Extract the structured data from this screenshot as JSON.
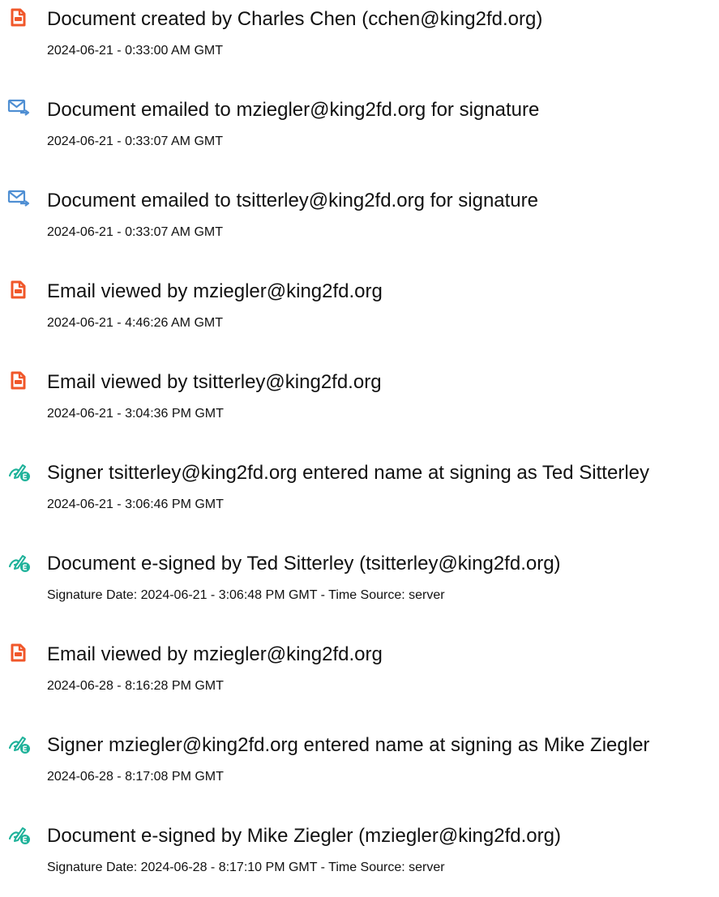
{
  "colors": {
    "doc_icon": "#f0572a",
    "email_icon": "#4f8fd3",
    "sign_icon": "#1fb29a"
  },
  "events": [
    {
      "icon": "document-icon",
      "title": "Document created by Charles Chen (cchen@king2fd.org)",
      "time": "2024-06-21 - 0:33:00 AM GMT"
    },
    {
      "icon": "email-sent-icon",
      "title": "Document emailed to mziegler@king2fd.org for signature",
      "time": "2024-06-21 - 0:33:07 AM GMT"
    },
    {
      "icon": "email-sent-icon",
      "title": "Document emailed to tsitterley@king2fd.org for signature",
      "time": "2024-06-21 - 0:33:07 AM GMT"
    },
    {
      "icon": "document-icon",
      "title": "Email viewed by mziegler@king2fd.org",
      "time": "2024-06-21 - 4:46:26 AM GMT"
    },
    {
      "icon": "document-icon",
      "title": "Email viewed by tsitterley@king2fd.org",
      "time": "2024-06-21 - 3:04:36 PM GMT"
    },
    {
      "icon": "signature-icon",
      "title": "Signer tsitterley@king2fd.org entered name at signing as Ted Sitterley",
      "time": "2024-06-21 - 3:06:46 PM GMT"
    },
    {
      "icon": "signature-icon",
      "title": "Document e-signed by Ted Sitterley (tsitterley@king2fd.org)",
      "time": "Signature Date: 2024-06-21 - 3:06:48 PM GMT - Time Source: server"
    },
    {
      "icon": "document-icon",
      "title": "Email viewed by mziegler@king2fd.org",
      "time": "2024-06-28 - 8:16:28 PM GMT"
    },
    {
      "icon": "signature-icon",
      "title": "Signer mziegler@king2fd.org entered name at signing as Mike Ziegler",
      "time": "2024-06-28 - 8:17:08 PM GMT"
    },
    {
      "icon": "signature-icon",
      "title": "Document e-signed by Mike Ziegler (mziegler@king2fd.org)",
      "time": "Signature Date: 2024-06-28 - 8:17:10 PM GMT - Time Source: server"
    }
  ]
}
